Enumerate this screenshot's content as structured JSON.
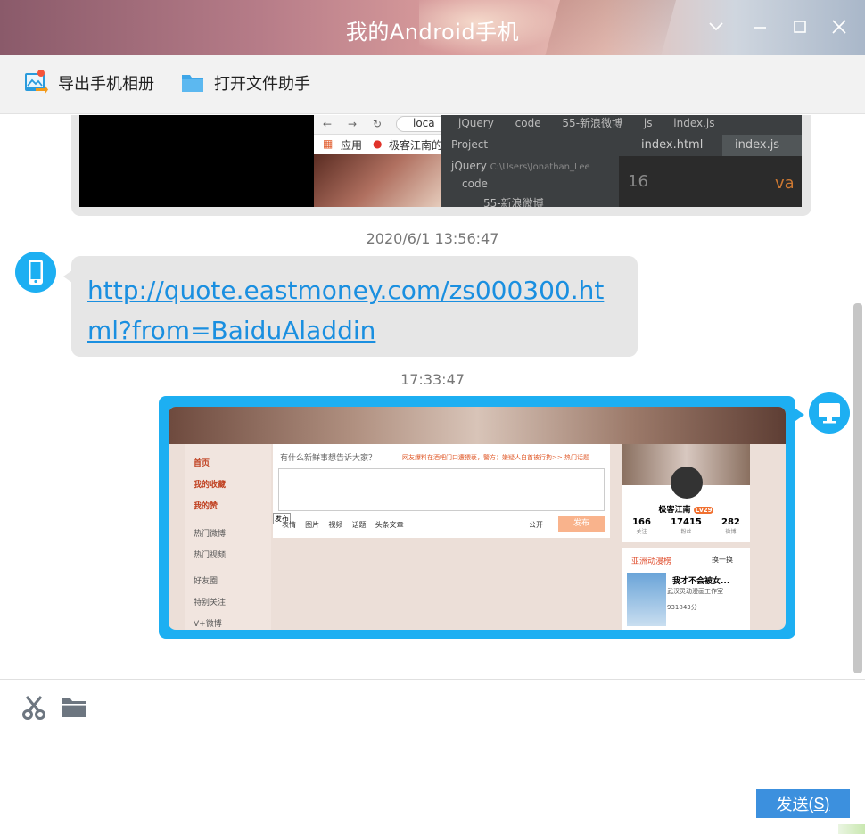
{
  "window": {
    "title": "我的Android手机"
  },
  "toolbar": {
    "export_label": "导出手机相册",
    "open_label": "打开文件助手"
  },
  "chat": {
    "timestamp1": "2020/6/1 13:56:47",
    "link": "http://quote.eastmoney.com/zs000300.html?from=BaiduAladdin",
    "timestamp2": "17:33:47"
  },
  "screenshot1": {
    "url_fragment": "loca",
    "bookmark_apps": "应用",
    "bookmark_site": "极客江南的",
    "breadcrumb": [
      "jQuery",
      "code",
      "55-新浪微博",
      "js",
      "index.js"
    ],
    "project_label": "Project",
    "tabs": [
      "index.html",
      "index.js"
    ],
    "tree_root": "jQuery",
    "tree_path": "C:\\Users\\Jonathan_Lee",
    "tree_child": "code",
    "tree_grandchild": "55-新浪微博",
    "line_number": "16",
    "code_text": "va"
  },
  "screenshot2": {
    "nav": [
      "首页",
      "我的收藏",
      "我的赞"
    ],
    "nav_sub": [
      "热门微博",
      "热门视频",
      "好友圈",
      "特别关注",
      "V+微博"
    ],
    "prompt": "有什么新鲜事想告诉大家？",
    "notice": "网友爆料在酒吧门口遭猥亵，警方：嫌疑人自首被行拘>>  热门话题",
    "publish_tooltip": "发布",
    "actions": [
      "表情",
      "图片",
      "视频",
      "话题",
      "头条文章"
    ],
    "visibility": "公开",
    "publish": "发布",
    "profile_name": "极客江南",
    "level": "Lv29",
    "stats": [
      {
        "value": "166",
        "label": "关注"
      },
      {
        "value": "17415",
        "label": "粉丝"
      },
      {
        "value": "282",
        "label": "微博"
      }
    ],
    "anime_title": "亚洲动漫榜",
    "refresh": "换一换",
    "anime_item": "我才不会被女...",
    "anime_studio": "武汉灵动漫画工作室",
    "anime_score": "931843分"
  },
  "input": {
    "send_label": "发送",
    "send_shortcut": "(S)"
  }
}
